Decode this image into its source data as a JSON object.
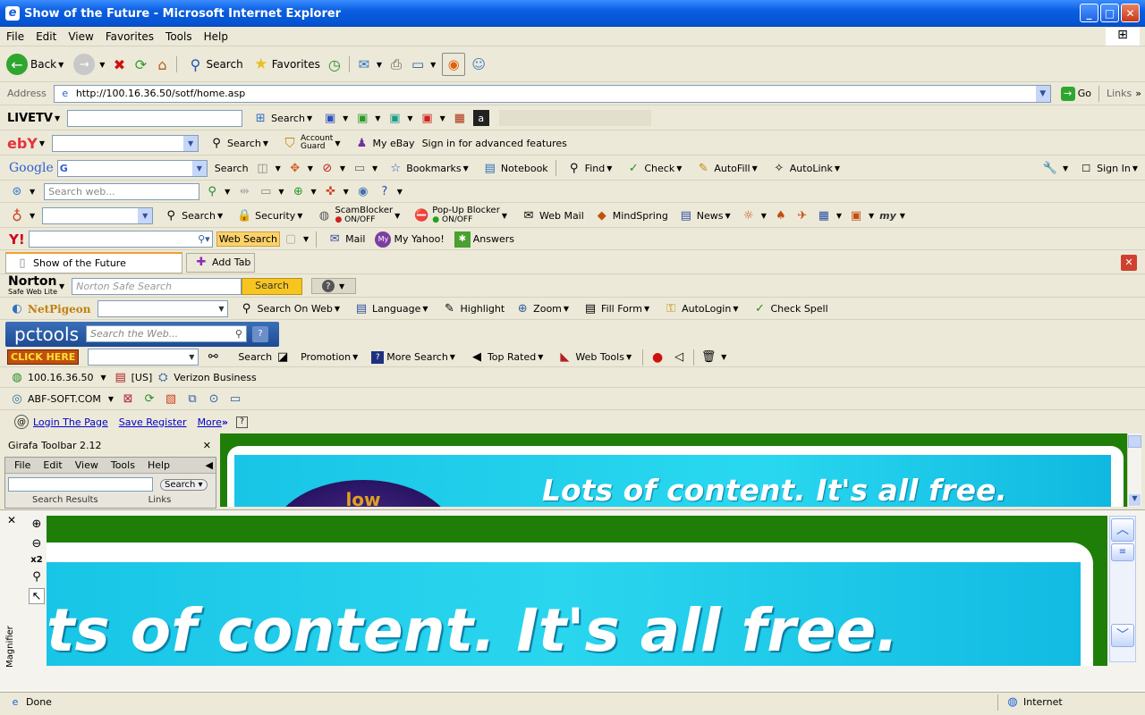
{
  "window": {
    "title": "Show of the Future - Microsoft Internet Explorer",
    "min": "_",
    "max": "□",
    "close": "✕"
  },
  "menu": [
    "File",
    "Edit",
    "View",
    "Favorites",
    "Tools",
    "Help"
  ],
  "std_toolbar": {
    "back": "Back",
    "search": "Search",
    "favorites": "Favorites"
  },
  "address": {
    "label": "Address",
    "url": "http://100.16.36.50/sotf/home.asp",
    "go": "Go",
    "links": "Links"
  },
  "livetv": {
    "logo": "LIVETV",
    "search": "Search"
  },
  "ebay": {
    "logo": "ebY",
    "search": "Search",
    "account_guard_1": "Account",
    "account_guard_2": "Guard",
    "my_ebay": "My eBay",
    "sign_in": "Sign in for advanced features"
  },
  "google": {
    "logo": "Google",
    "search": "Search",
    "bookmarks": "Bookmarks",
    "notebook": "Notebook",
    "find": "Find",
    "check": "Check",
    "autofill": "AutoFill",
    "autolink": "AutoLink",
    "sign_in": "Sign In"
  },
  "msn": {
    "placeholder": "Search web..."
  },
  "earthlink": {
    "search": "Search",
    "security": "Security",
    "scamblocker": "ScamBlocker",
    "scam_state": "ON/OFF",
    "popup": "Pop-Up Blocker",
    "popup_state": "ON/OFF",
    "webmail": "Web Mail",
    "mindspring": "MindSpring",
    "news": "News",
    "my": "my"
  },
  "yahoo": {
    "logo": "Y!",
    "web_search": "Web Search",
    "mail": "Mail",
    "my_yahoo": "My Yahoo!",
    "answers": "Answers"
  },
  "tabs": {
    "tab1": "Show of the Future",
    "add_tab": "Add Tab"
  },
  "norton": {
    "logo": "Norton",
    "sub": "Safe Web Lite",
    "placeholder": "Norton Safe Search",
    "search": "Search"
  },
  "netpigeon": {
    "logo": "NetPigeon",
    "search_on_web": "Search On Web",
    "language": "Language",
    "highlight": "Highlight",
    "zoom": "Zoom",
    "fill_form": "Fill Form",
    "autologin": "AutoLogin",
    "check_spell": "Check Spell"
  },
  "pctools": {
    "logo": "pctools",
    "placeholder": "Search the Web..."
  },
  "clickhere": {
    "logo": "CLICK HERE",
    "search": "Search",
    "promotion": "Promotion",
    "more_search": "More Search",
    "top_rated": "Top Rated",
    "web_tools": "Web Tools"
  },
  "ipbar": {
    "ip": "100.16.36.50",
    "country": "[US]",
    "isp": "Verizon Business"
  },
  "abf": {
    "label": "ABF-SOFT.COM"
  },
  "login": {
    "login": "Login The Page",
    "save": "Save Register",
    "more": "More"
  },
  "girafa": {
    "title": "Girafa Toolbar 2.12",
    "close": "✕",
    "menu": [
      "File",
      "Edit",
      "View",
      "Tools",
      "Help"
    ],
    "search": "Search",
    "tab1": "Search Results",
    "tab2": "Links"
  },
  "page": {
    "headline": "Lots of content. It's all free.",
    "globe_text": "low"
  },
  "magnifier": {
    "label": "Magnifier",
    "zoom": "x2",
    "headline": "ts of content. It's all free."
  },
  "status": {
    "done": "Done",
    "zone": "Internet"
  }
}
